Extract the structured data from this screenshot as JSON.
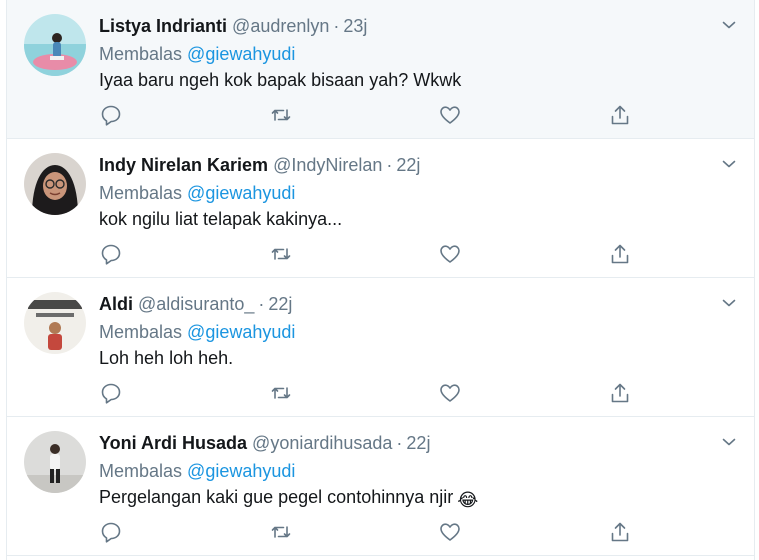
{
  "colors": {
    "name": "#14171a",
    "muted": "#657786",
    "link": "#1b95e0",
    "hover_background": "#f5f8fa",
    "divider": "#e6ecf0"
  },
  "tweets": [
    {
      "name": "Listya Indrianti",
      "handle": "@audrenlyn",
      "separator": "·",
      "time": "23j",
      "reply_prefix": "Membalas",
      "reply_to": "@giewahyudi",
      "text": "Iyaa baru ngeh kok bapak bisaan yah? Wkwk",
      "avatar": "avatar-beach-photo",
      "highlighted": true
    },
    {
      "name": "Indy Nirelan Kariem",
      "handle": "@IndyNirelan",
      "separator": "·",
      "time": "22j",
      "reply_prefix": "Membalas",
      "reply_to": "@giewahyudi",
      "text": "kok ngilu liat telapak kakinya...",
      "avatar": "avatar-hijab-glasses-photo"
    },
    {
      "name": "Aldi",
      "handle": "@aldisuranto_",
      "separator": "·",
      "time": "22j",
      "reply_prefix": "Membalas",
      "reply_to": "@giewahyudi",
      "text": "Loh heh loh heh.",
      "avatar": "avatar-cattery-photo"
    },
    {
      "name": "Yoni Ardi Husada",
      "handle": "@yoniardihusada",
      "separator": "·",
      "time": "22j",
      "reply_prefix": "Membalas",
      "reply_to": "@giewahyudi",
      "text": "Pergelangan kaki gue pegel contohinnya njir",
      "emoji": "😂",
      "avatar": "avatar-standing-person-photo"
    }
  ],
  "icons": [
    "reply-icon",
    "retweet-icon",
    "like-icon",
    "share-icon",
    "caret-down-icon"
  ]
}
